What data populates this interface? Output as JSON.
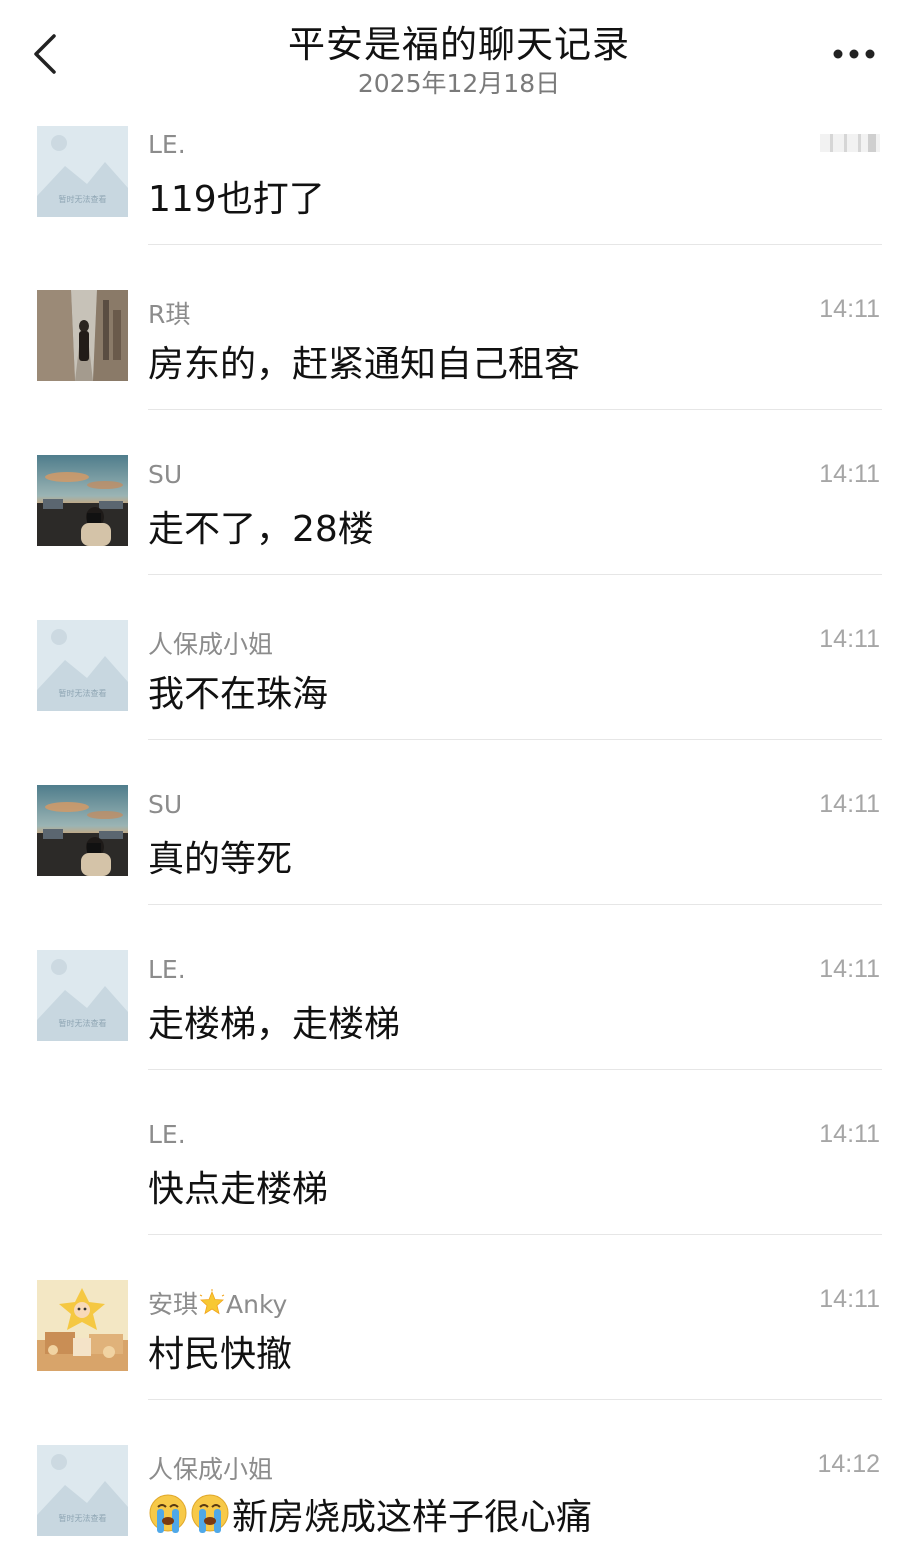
{
  "header": {
    "title": "平安是福的聊天记录",
    "date": "2025年12月18日"
  },
  "messages": [
    {
      "sender": "LE.",
      "time": "",
      "text": "119也打了",
      "avatar": "placeholder"
    },
    {
      "sender": "R琪",
      "time": "14:11",
      "text": "房东的，赶紧通知自己租客",
      "avatar": "alley"
    },
    {
      "sender": "SU",
      "time": "14:11",
      "text": "走不了，28楼",
      "avatar": "sunset"
    },
    {
      "sender": "人保成小姐",
      "time": "14:11",
      "text": "我不在珠海",
      "avatar": "placeholder"
    },
    {
      "sender": "SU",
      "time": "14:11",
      "text": "真的等死",
      "avatar": "sunset"
    },
    {
      "sender": "LE.",
      "time": "14:11",
      "text": "走楼梯，走楼梯",
      "avatar": "placeholder"
    },
    {
      "sender": "LE.",
      "time": "14:11",
      "text": "快点走楼梯",
      "avatar": "none"
    },
    {
      "sender_prefix": "安琪",
      "sender_suffix": "Anky",
      "time": "14:11",
      "text": "村民快撤",
      "avatar": "toy"
    },
    {
      "sender": "人保成小姐",
      "time": "14:12",
      "text": "新房烧成这样子很心痛",
      "avatar": "placeholder",
      "emoji": "crying-face-icon"
    }
  ],
  "placeholder_caption": "暂时无法查看",
  "colors": {
    "sender": "#8c8c8c",
    "time": "#a6a6a6",
    "divider": "#e6e6e6",
    "placeholder_bg": "#dde8ee"
  }
}
